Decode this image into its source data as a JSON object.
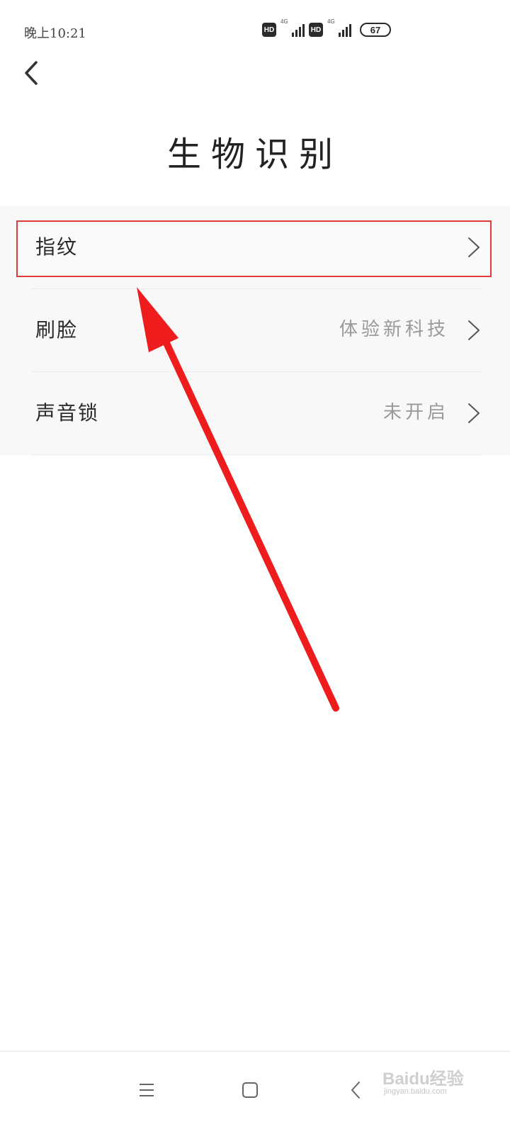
{
  "status_bar": {
    "time": "晚上10:21",
    "hd_label": "HD",
    "network_tag": "4G",
    "battery": "67"
  },
  "header": {
    "title": "生物识别"
  },
  "list": {
    "items": [
      {
        "label": "指纹",
        "value": ""
      },
      {
        "label": "刷脸",
        "value": "体验新科技"
      },
      {
        "label": "声音锁",
        "value": "未开启"
      }
    ]
  },
  "annotation": {
    "color": "#ee1c1c"
  },
  "watermark": {
    "main": "Baidu经验",
    "sub": "jingyan.baidu.com"
  }
}
